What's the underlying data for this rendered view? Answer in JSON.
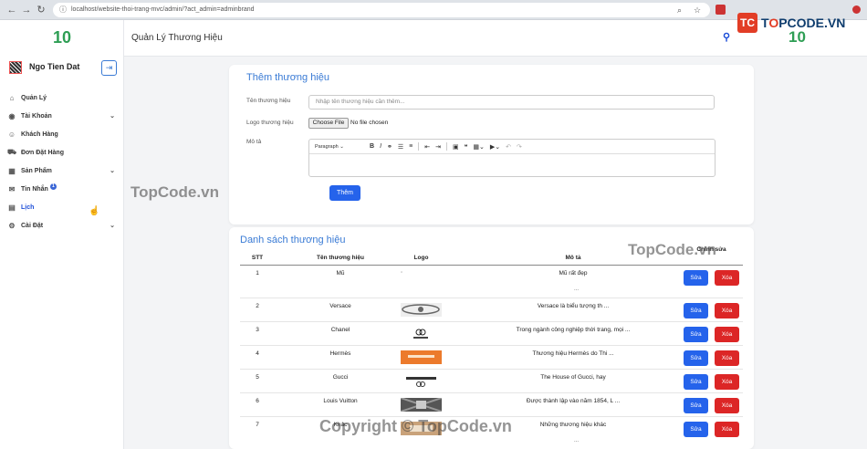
{
  "browser": {
    "url": "localhost/website-thoi-trang-mvc/admin/?act_admin=adminbrand"
  },
  "brand": {
    "logo_letters": "TC",
    "name_pre": "T",
    "name_o": "O",
    "name_post": "PCODE.VN"
  },
  "sidebar": {
    "logo": "10",
    "username": "Ngo Tien Dat",
    "menu": [
      {
        "label": "Quản Lý",
        "icon": "home-icon"
      },
      {
        "label": "Tài Khoản",
        "icon": "user-circle-icon"
      },
      {
        "label": "Khách Hàng",
        "icon": "user-icon"
      },
      {
        "label": "Đơn Đặt Hàng",
        "icon": "cart-icon"
      },
      {
        "label": "Sản Phẩm",
        "icon": "grid-icon"
      },
      {
        "label": "Tin Nhắn",
        "icon": "chat-icon",
        "badge": "1"
      },
      {
        "label": "Lịch",
        "icon": "calendar-icon"
      },
      {
        "label": "Cài Đặt",
        "icon": "gear-icon"
      }
    ]
  },
  "topbar": {
    "title": "Quản Lý Thương Hiệu",
    "logo": "10"
  },
  "add_form": {
    "title": "Thêm thương hiệu",
    "name_label": "Tên thương hiệu",
    "name_placeholder": "Nhập tên thương hiệu cần thêm...",
    "logo_label": "Logo thương hiệu",
    "file_button": "Choose File",
    "file_status": "No file chosen",
    "desc_label": "Mô tả",
    "paragraph": "Paragraph",
    "submit": "Thêm"
  },
  "list": {
    "title": "Danh sách thương hiệu",
    "headers": {
      "stt": "STT",
      "name": "Tên thương hiệu",
      "logo": "Logo",
      "desc": "Mô tả",
      "action": "Chỉnh sửa"
    },
    "edit_label": "Sửa",
    "delete_label": "Xóa",
    "rows": [
      {
        "stt": "1",
        "name": "Mũ",
        "desc": "Mũ rất đẹp",
        "dots": "...",
        "logo": "broken"
      },
      {
        "stt": "2",
        "name": "Versace",
        "desc": "Versace là biểu tượng th ...",
        "logo": "versace"
      },
      {
        "stt": "3",
        "name": "Chanel",
        "desc": "Trong ngành công nghiệp thời trang, mọi ...",
        "logo": "chanel"
      },
      {
        "stt": "4",
        "name": "Hermès",
        "desc": "Thương hiệu Hermès do Thi ...",
        "logo": "hermes"
      },
      {
        "stt": "5",
        "name": "Gucci",
        "desc": "The House of Gucci, hay",
        "logo": "gucci"
      },
      {
        "stt": "6",
        "name": "Louis Vuitton",
        "desc": "Được thành lập vào năm 1854, L ...",
        "logo": "lv"
      },
      {
        "stt": "7",
        "name": "Khác",
        "desc": "Những thương hiệu khác",
        "dots": "...",
        "logo": "other"
      }
    ]
  },
  "watermarks": {
    "w1": "TopCode.vn",
    "w2": "TopCode.vn",
    "w3": "Copyright © TopCode.vn"
  },
  "colors": {
    "primary": "#2563eb",
    "danger": "#dc2626",
    "title_blue": "#3a7bd5",
    "logo_green": "#2e9e54"
  }
}
